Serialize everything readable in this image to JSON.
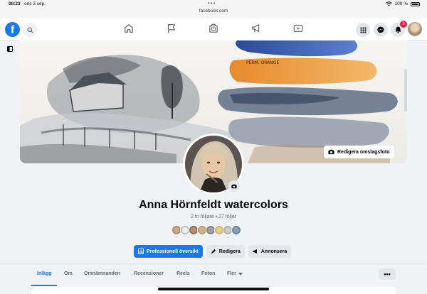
{
  "status": {
    "time": "08:23",
    "date": "ons 3 sep.",
    "url": "facebook.com",
    "dots": "•••",
    "battery": "100 %"
  },
  "nav": {
    "logo": "f",
    "notification_count": "3",
    "icons": [
      "search-icon",
      "home-icon",
      "flag-icon",
      "marketplace-icon",
      "megaphone-icon",
      "video-icon",
      "grid-menu-icon",
      "messenger-icon",
      "bell-icon"
    ]
  },
  "cover": {
    "edit_label": "Redigera omslagsfoto",
    "painting_text": "PERM. ORANGE"
  },
  "profile": {
    "name": "Anna Hörnfeldt watercolors",
    "stats": "2 tn följare • 27 följer"
  },
  "actions": {
    "dashboard": "Professionell översikt",
    "edit": "Redigera",
    "advertise": "Annonsera"
  },
  "tabs": {
    "posts": "Inlägg",
    "about": "Om",
    "mentions": "Omnämnanden",
    "reviews": "Recensioner",
    "reels": "Reels",
    "photos": "Foton",
    "more": "Fler",
    "more_options": "•••"
  },
  "colors": {
    "brand": "#1877f2",
    "badge": "#e41e3f"
  }
}
